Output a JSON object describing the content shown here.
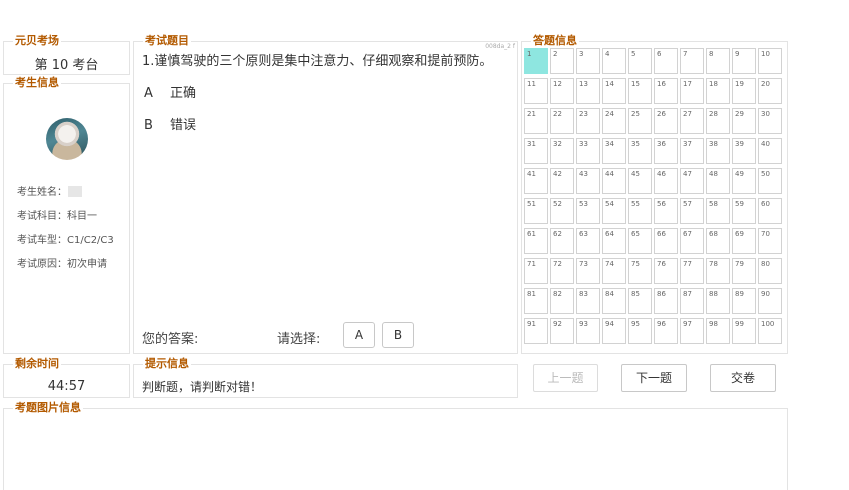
{
  "venue": {
    "legend": "元贝考场",
    "value": "第 10 考台"
  },
  "examinee": {
    "legend": "考生信息",
    "name_label": "考生姓名：",
    "name_value": "",
    "subject_label": "考试科目：",
    "subject_value": "科目一",
    "vehicle_label": "考试车型：",
    "vehicle_value": "C1/C2/C3",
    "reason_label": "考试原因：",
    "reason_value": "初次申请"
  },
  "timer": {
    "legend": "剩余时间",
    "value": "44:57"
  },
  "question": {
    "legend": "考试题目",
    "code": "008da_2 f",
    "text": "1.谨慎驾驶的三个原则是集中注意力、仔细观察和提前预防。",
    "options": [
      {
        "letter": "A",
        "text": "正确"
      },
      {
        "letter": "B",
        "text": "错误"
      }
    ],
    "answer_label": "您的答案:",
    "choose_label": "请选择:",
    "choices": [
      "A",
      "B"
    ]
  },
  "hint": {
    "legend": "提示信息",
    "value": "判断题，请判断对错！"
  },
  "answers": {
    "legend": "答题信息",
    "current": 1,
    "numbers": [
      "1",
      "2",
      "3",
      "4",
      "5",
      "6",
      "7",
      "8",
      "9",
      "10",
      "11",
      "12",
      "13",
      "14",
      "15",
      "16",
      "17",
      "18",
      "19",
      "20",
      "21",
      "22",
      "23",
      "24",
      "25",
      "26",
      "27",
      "28",
      "29",
      "30",
      "31",
      "32",
      "33",
      "34",
      "35",
      "36",
      "37",
      "38",
      "39",
      "40",
      "41",
      "42",
      "43",
      "44",
      "45",
      "46",
      "47",
      "48",
      "49",
      "50",
      "51",
      "52",
      "53",
      "54",
      "55",
      "56",
      "57",
      "58",
      "59",
      "60",
      "61",
      "62",
      "63",
      "64",
      "65",
      "66",
      "67",
      "68",
      "69",
      "70",
      "71",
      "72",
      "73",
      "74",
      "75",
      "76",
      "77",
      "78",
      "79",
      "80",
      "81",
      "82",
      "83",
      "84",
      "85",
      "86",
      "87",
      "88",
      "89",
      "90",
      "91",
      "92",
      "93",
      "94",
      "95",
      "96",
      "97",
      "98",
      "99",
      "100"
    ]
  },
  "nav": {
    "prev_label": "上一题",
    "next_label": "下一题",
    "submit_label": "交卷"
  },
  "image_area": {
    "legend": "考题图片信息"
  },
  "colors": {
    "accent": "#b35a00",
    "current_cell": "#8ee6e0"
  }
}
